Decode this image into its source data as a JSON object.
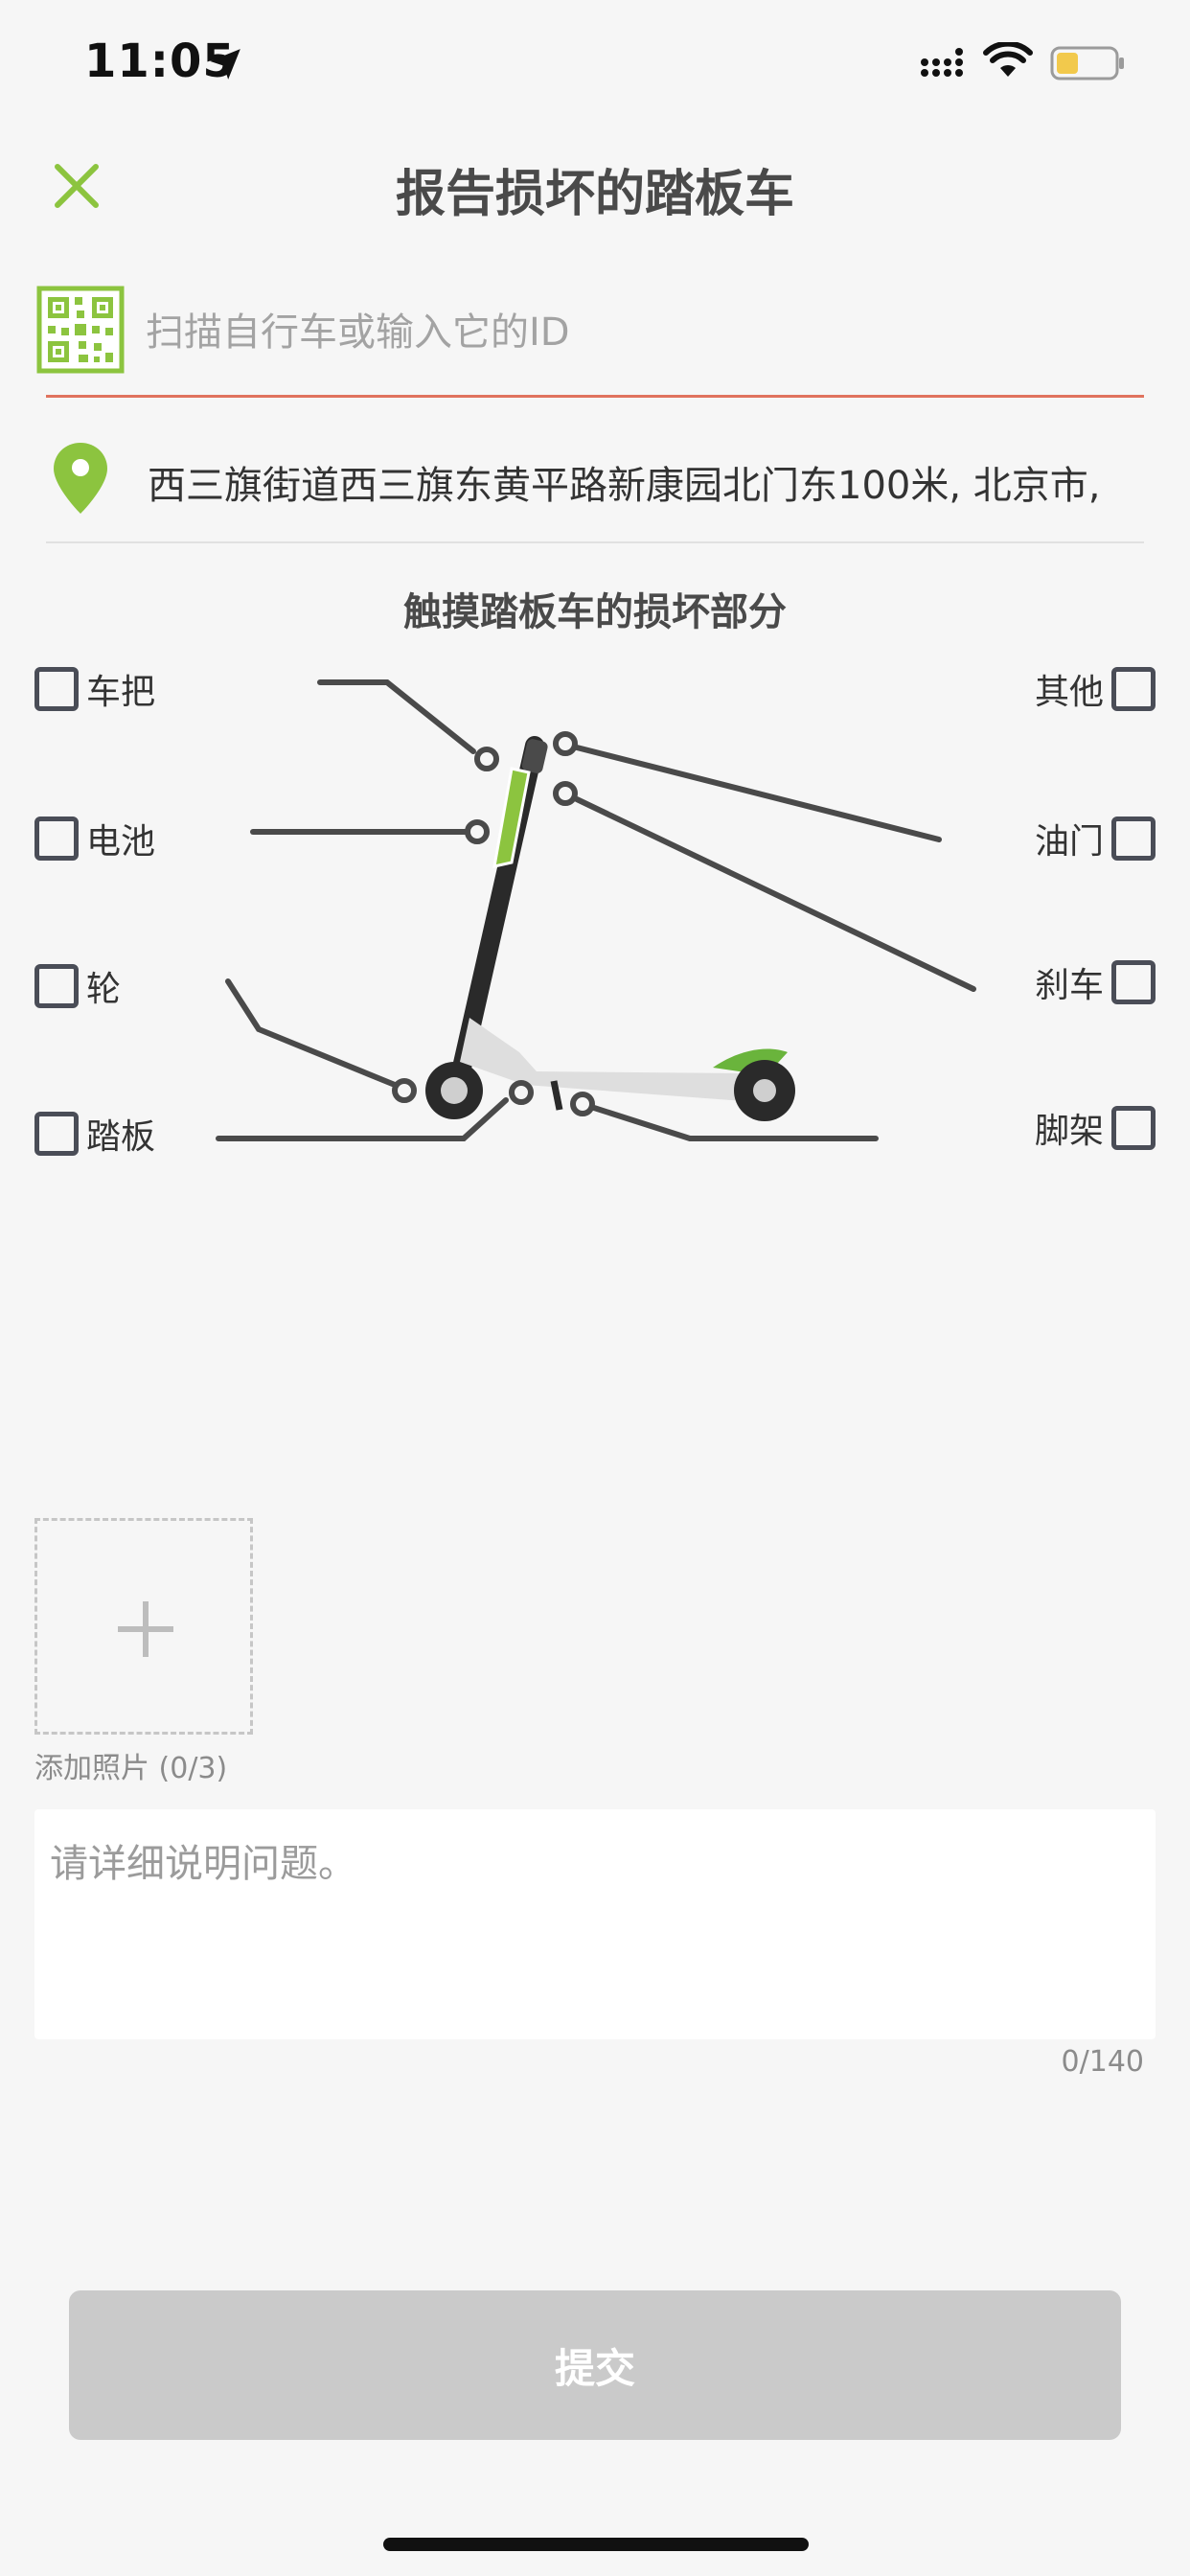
{
  "status_bar": {
    "time": "11:05"
  },
  "nav": {
    "title": "报告损坏的踏板车"
  },
  "scan": {
    "placeholder": "扫描自行车或输入它的ID",
    "value": ""
  },
  "location": {
    "address": "西三旗街道西三旗东黄平路新康园北门东100米, 北京市,"
  },
  "parts": {
    "title": "触摸踏板车的损坏部分",
    "left": [
      {
        "label": "车把",
        "checked": false
      },
      {
        "label": "电池",
        "checked": false
      },
      {
        "label": "轮",
        "checked": false
      },
      {
        "label": "踏板",
        "checked": false
      }
    ],
    "right": [
      {
        "label": "其他",
        "checked": false
      },
      {
        "label": "油门",
        "checked": false
      },
      {
        "label": "刹车",
        "checked": false
      },
      {
        "label": "脚架",
        "checked": false
      }
    ]
  },
  "photos": {
    "label": "添加照片 (0/3)"
  },
  "description": {
    "placeholder": "请详细说明问题。",
    "counter": "0/140"
  },
  "submit": {
    "label": "提交"
  },
  "colors": {
    "accent_green": "#8cc43f",
    "scan_underline": "#e0735e",
    "submit_disabled": "#cacaca"
  }
}
